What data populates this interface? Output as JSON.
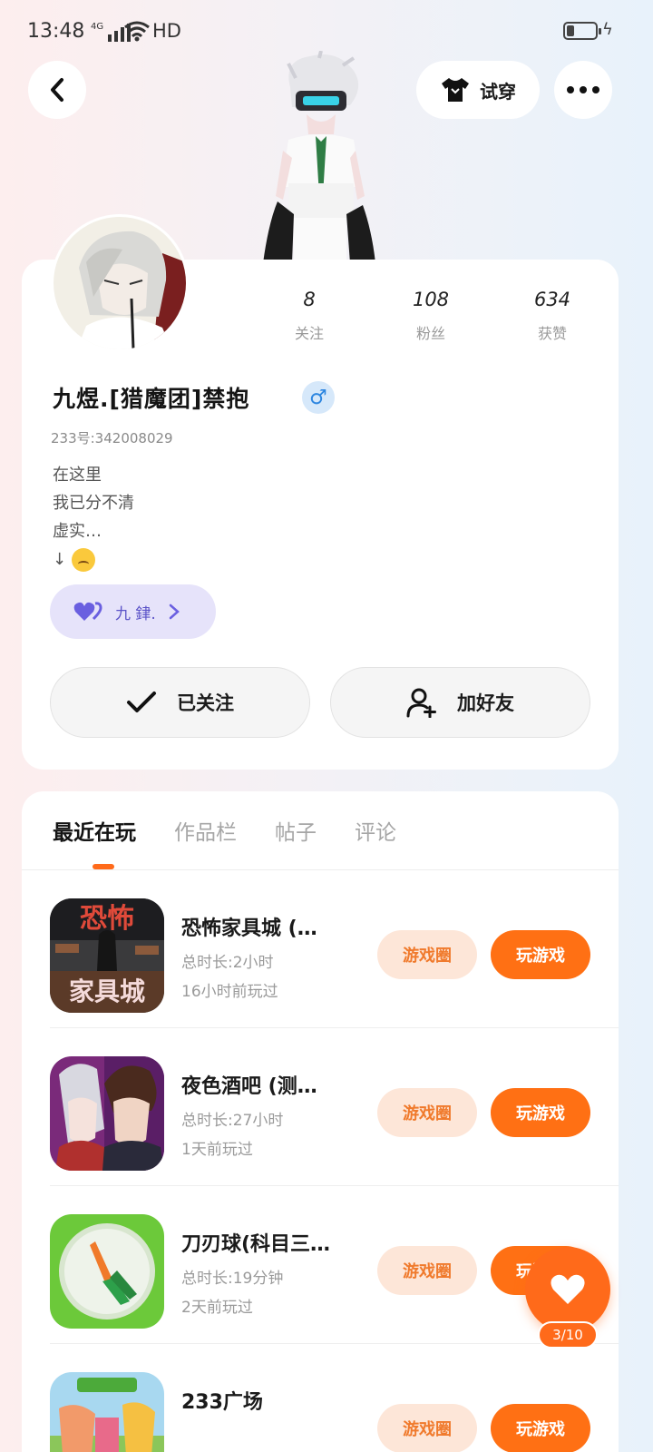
{
  "status_bar": {
    "time": "13:48",
    "network": "4G",
    "hd": "HD"
  },
  "header": {
    "tryon_label": "试穿"
  },
  "profile": {
    "stats": [
      {
        "value": "8",
        "label": "关注"
      },
      {
        "value": "108",
        "label": "粉丝"
      },
      {
        "value": "634",
        "label": "获赞"
      }
    ],
    "nickname": "九煜.[猎魔团]禁抱",
    "gender_symbol": "♂",
    "uid": "233号:342008029",
    "bio_lines": [
      "在这里",
      "我已分不清",
      "虚实…",
      "↓"
    ],
    "relation_label": "九 銉.",
    "follow_label": "已关注",
    "add_friend_label": "加好友"
  },
  "tabs": [
    {
      "label": "最近在玩",
      "active": true
    },
    {
      "label": "作品栏",
      "active": false
    },
    {
      "label": "帖子",
      "active": false
    },
    {
      "label": "评论",
      "active": false
    }
  ],
  "games": [
    {
      "name": "恐怖家具城 (…",
      "icon_text_top": "恐怖",
      "icon_text_bottom": "家具城",
      "total_time": "总时长:2小时",
      "last_played": "16小时前玩过",
      "circle_label": "游戏圈",
      "play_label": "玩游戏"
    },
    {
      "name": "夜色酒吧 (测…",
      "total_time": "总时长:27小时",
      "last_played": "1天前玩过",
      "circle_label": "游戏圈",
      "play_label": "玩游戏"
    },
    {
      "name": "刀刃球(科目三…",
      "total_time": "总时长:19分钟",
      "last_played": "2天前玩过",
      "circle_label": "游戏圈",
      "play_label": "玩游戏"
    },
    {
      "name": "233广场",
      "total_time": "",
      "last_played": "",
      "circle_label": "游戏圈",
      "play_label": "玩游戏"
    }
  ],
  "fab": {
    "count": "3/10"
  },
  "colors": {
    "accent": "#ff7014",
    "accent_soft": "#fde6d8",
    "gender_blue": "#2d86e0",
    "relation_purple": "#5b53c8"
  }
}
